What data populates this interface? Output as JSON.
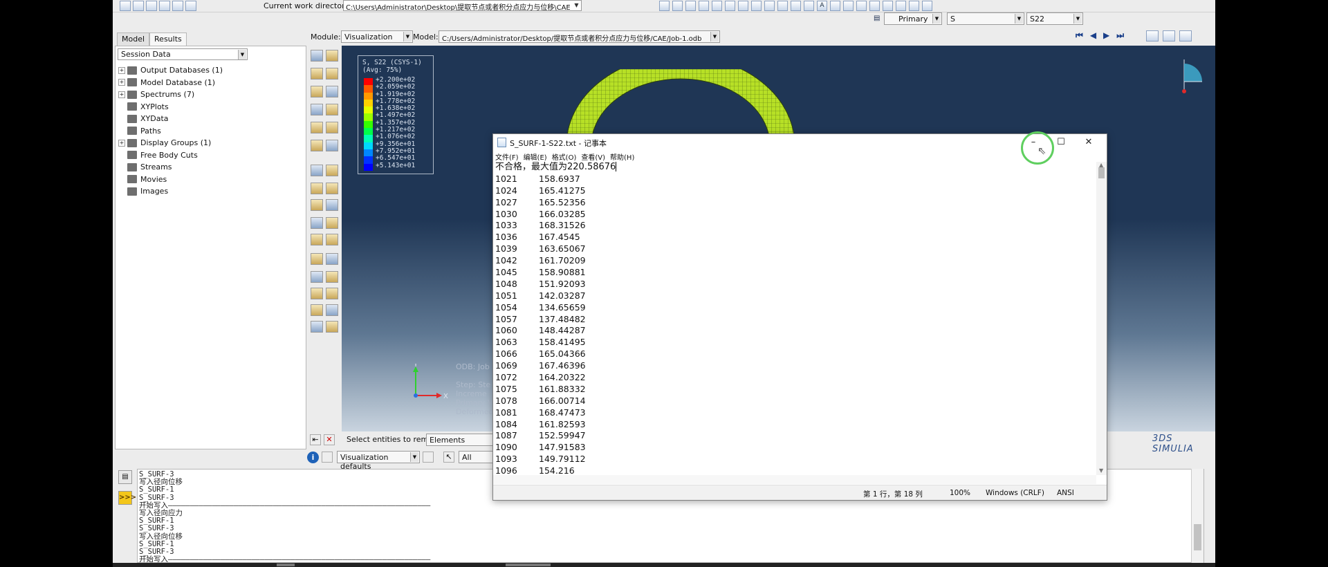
{
  "toolbar": {
    "cwd_label": "Current work directory:",
    "cwd_value": "C:\\Users\\Administrator\\Desktop\\提取节点或者积分点应力与位移\\CAE"
  },
  "tabs": [
    {
      "label": "Model"
    },
    {
      "label": "Results"
    }
  ],
  "module": {
    "label": "Module:",
    "value": "Visualization"
  },
  "model": {
    "label": "Model:",
    "value": "C:/Users/Administrator/Desktop/提取节点或者积分点应力与位移/CAE/Job-1.odb"
  },
  "field_output": {
    "primary": "Primary",
    "variable": "S",
    "component": "S22"
  },
  "session_box": "Session Data",
  "tree": [
    {
      "label": "Output Databases (1)",
      "expandable": true
    },
    {
      "label": "Model Database (1)",
      "expandable": true
    },
    {
      "label": "Spectrums (7)",
      "expandable": true
    },
    {
      "label": "XYPlots",
      "expandable": false
    },
    {
      "label": "XYData",
      "expandable": false
    },
    {
      "label": "Paths",
      "expandable": false
    },
    {
      "label": "Display Groups (1)",
      "expandable": true
    },
    {
      "label": "Free Body Cuts",
      "expandable": false
    },
    {
      "label": "Streams",
      "expandable": false
    },
    {
      "label": "Movies",
      "expandable": false
    },
    {
      "label": "Images",
      "expandable": false
    }
  ],
  "legend": {
    "title1": "S, S22 (CSYS-1)",
    "title2": "(Avg: 75%)",
    "values": [
      "+2.200e+02",
      "+2.059e+02",
      "+1.919e+02",
      "+1.778e+02",
      "+1.638e+02",
      "+1.497e+02",
      "+1.357e+02",
      "+1.217e+02",
      "+1.076e+02",
      "+9.356e+01",
      "+7.952e+01",
      "+6.547e+01",
      "+5.143e+01"
    ],
    "colors": [
      "#ff0000",
      "#ff5a00",
      "#ff9900",
      "#ffd200",
      "#e6ff00",
      "#9cff00",
      "#34ff00",
      "#00ff4a",
      "#00ffb4",
      "#00d8ff",
      "#0087ff",
      "#0032ff",
      "#0000ff"
    ]
  },
  "viewport": {
    "odb_line": "ODB: Job",
    "info_lines": [
      "Step: Ste",
      "Increme",
      "Primary V",
      "Deformed"
    ]
  },
  "triad": {
    "x": "X",
    "y": "Y"
  },
  "brand": "3DS SIMULIA",
  "selection": {
    "label": "Select entities to remove:",
    "value": "Elements"
  },
  "visdefaults": {
    "value": "Visualization defaults",
    "all": "All"
  },
  "messages": [
    "S_SURF-3",
    "写入径向位移",
    "S_SURF-1",
    "S_SURF-3",
    "开始写入————————————————————————————————————————————————————————————",
    "写入径向应力",
    "S_SURF-1",
    "S_SURF-3",
    "写入径向位移",
    "S_SURF-1",
    "S_SURF-3",
    "开始写入————————————————————————————————————————————————————————————"
  ],
  "notepad": {
    "title": "S_SURF-1-S22.txt - 记事本",
    "menu": [
      "文件(F)",
      "编辑(E)",
      "格式(O)",
      "查看(V)",
      "帮助(H)"
    ],
    "header_line": "不合格，最大值为220.58676",
    "rows": [
      [
        "1021",
        "158.6937"
      ],
      [
        "1024",
        "165.41275"
      ],
      [
        "1027",
        "165.52356"
      ],
      [
        "1030",
        "166.03285"
      ],
      [
        "1033",
        "168.31526"
      ],
      [
        "1036",
        "167.4545"
      ],
      [
        "1039",
        "163.65067"
      ],
      [
        "1042",
        "161.70209"
      ],
      [
        "1045",
        "158.90881"
      ],
      [
        "1048",
        "151.92093"
      ],
      [
        "1051",
        "142.03287"
      ],
      [
        "1054",
        "134.65659"
      ],
      [
        "1057",
        "137.48482"
      ],
      [
        "1060",
        "148.44287"
      ],
      [
        "1063",
        "158.41495"
      ],
      [
        "1066",
        "165.04366"
      ],
      [
        "1069",
        "167.46396"
      ],
      [
        "1072",
        "164.20322"
      ],
      [
        "1075",
        "161.88332"
      ],
      [
        "1078",
        "166.00714"
      ],
      [
        "1081",
        "168.47473"
      ],
      [
        "1084",
        "161.82593"
      ],
      [
        "1087",
        "152.59947"
      ],
      [
        "1090",
        "147.91583"
      ],
      [
        "1093",
        "149.79112"
      ],
      [
        "1096",
        "154.216"
      ]
    ],
    "status": {
      "position": "第 1 行，第 18 列",
      "zoom": "100%",
      "line_ending": "Windows (CRLF)",
      "encoding": "ANSI"
    }
  }
}
